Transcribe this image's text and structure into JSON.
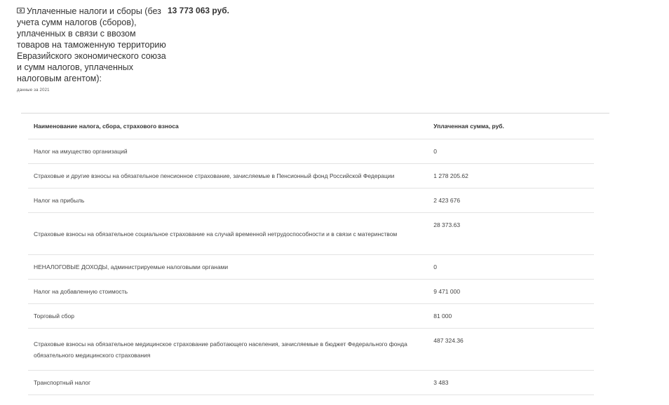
{
  "summary": {
    "label": "Уплаченные налоги и сборы (без учета сумм налогов (сборов), уплаченных в связи с ввозом товаров на таможенную территорию Евразийского экономического союза и сумм налогов, уплаченных налоговым агентом):",
    "note": "данные за 2021",
    "amount": "13 773 063 руб.",
    "icon": "money-icon"
  },
  "table": {
    "headers": {
      "name": "Наименование налога, сбора, страхового взноса",
      "amount": "Уплаченная сумма, руб."
    },
    "rows": [
      {
        "name": "Налог на имущество организаций",
        "amount": "0"
      },
      {
        "name": "Страховые и другие взносы на обязательное пенсионное страхование, зачисляемые в Пенсионный фонд Российской Федерации",
        "amount": "1 278 205.62"
      },
      {
        "name": "Налог на прибыль",
        "amount": "2 423 676"
      },
      {
        "name": "Страховые взносы на обязательное социальное страхование на случай временной нетрудоспособности и в связи с материнством",
        "amount": "28 373.63"
      },
      {
        "name": "НЕНАЛОГОВЫЕ ДОХОДЫ, администрируемые налоговыми органами",
        "amount": "0"
      },
      {
        "name": "Налог на добавленную стоимость",
        "amount": "9 471 000"
      },
      {
        "name": "Торговый сбор",
        "amount": "81 000"
      },
      {
        "name": "Страховые взносы на обязательное медицинское страхование работающего населения, зачисляемые в бюджет Федерального фонда обязательного медицинского страхования",
        "amount": "487 324.36"
      },
      {
        "name": "Транспортный налог",
        "amount": "3 483"
      }
    ]
  }
}
